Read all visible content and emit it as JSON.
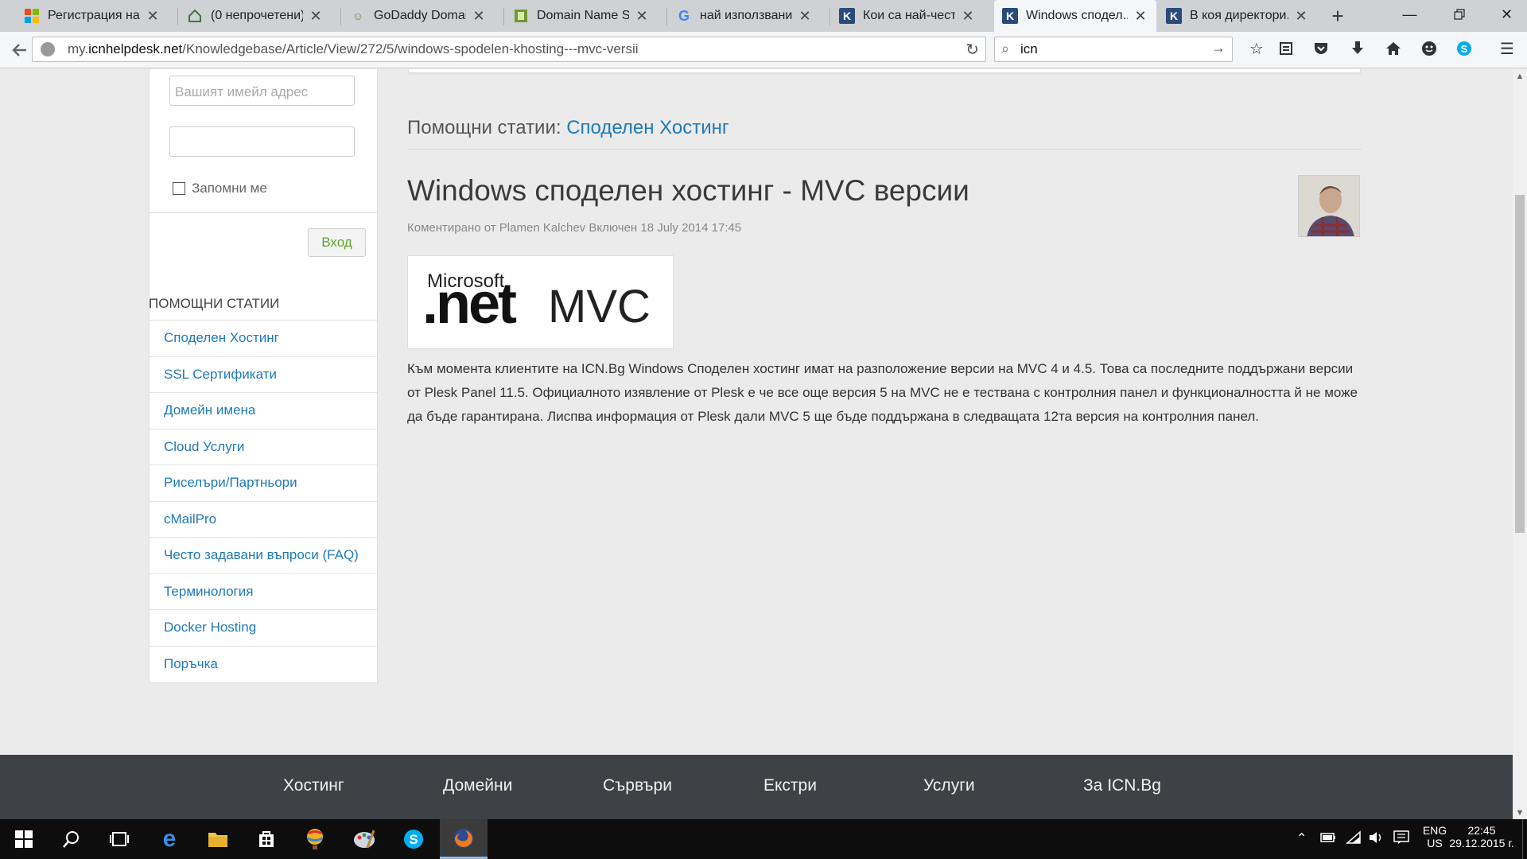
{
  "tabs": [
    {
      "title": "Регистрация на ...",
      "icon": "windows-logo-icon"
    },
    {
      "title": "(0 непрочетени)...",
      "icon": "home-page-icon"
    },
    {
      "title": "GoDaddy Domai...",
      "icon": "godaddy-icon"
    },
    {
      "title": "Domain Name S...",
      "icon": "domain-site-icon"
    },
    {
      "title": "най използвани...",
      "icon": "google-icon"
    },
    {
      "title": "Кои са най-чест...",
      "icon": "kayako-icon"
    },
    {
      "title": "Windows сподел...",
      "icon": "kayako-icon"
    },
    {
      "title": "В коя директори...",
      "icon": "kayako-icon"
    }
  ],
  "address_bar": {
    "url_prefix": "my.",
    "url_host": "icnhelpdesk.net",
    "url_path": "/Knowledgebase/Article/View/272/5/windows-spodelen-khosting---mvc-versii"
  },
  "search_bar": {
    "value": "icn"
  },
  "login": {
    "email_placeholder": "Вашият имейл адрес",
    "remember_label": "Запомни ме",
    "submit_label": "Вход"
  },
  "sidebar": {
    "heading": "ПОМОЩНИ СТАТИИ",
    "items": [
      "Споделен Хостинг",
      "SSL Сертификати",
      "Домейн имена",
      "Cloud Услуги",
      "Риселъри/Партньори",
      "cMailPro",
      "Често задавани въпроси (FAQ)",
      "Терминология",
      "Docker Hosting",
      "Поръчка"
    ]
  },
  "breadcrumb": {
    "prefix": "Помощни статии: ",
    "category": "Споделен Хостинг"
  },
  "article": {
    "title": "Windows споделен хостинг - MVC версии",
    "meta": "Коментирано от Plamen Kalchev Включен 18 July 2014 17:45",
    "image_text": {
      "microsoft": "Microsoft",
      "net": ".net",
      "mvc": "MVC"
    },
    "body": "Към момента клиентите на ICN.Bg Windows Споделен хостинг имат на разположение версии на MVC 4 и 4.5. Това са последните поддържани версии от Plesk Panel 11.5. Официалното изявление от Plesk е че все още версия 5 на MVC не е тествана с контролния панел и функционалността й не може да бъде гарантирана. Лиспва информация от Plesk дали MVC 5 ще бъде поддържана в следващата 12та версия на контролния панел."
  },
  "footer": {
    "columns": [
      "Хостинг",
      "Домейни",
      "Сървъри",
      "Екстри",
      "Услуги",
      "За ICN.Bg"
    ]
  },
  "taskbar": {
    "language": "ENG",
    "locale": "US",
    "time": "22:45",
    "date": "29.12.2015 г."
  },
  "colors": {
    "link": "#1f7ab8",
    "accent_green": "#7fbf3c",
    "footer_bg": "#3e4145",
    "taskbar_bg": "#0d0d0d"
  }
}
